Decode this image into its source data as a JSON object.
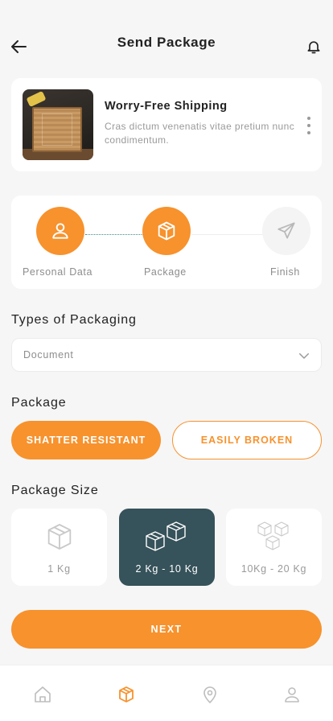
{
  "header": {
    "title": "Send Package",
    "back_icon": "arrow-left-icon",
    "bell_icon": "bell-icon"
  },
  "promo": {
    "title": "Worry-Free Shipping",
    "description": "Cras dictum venenatis vitae pretium nunc condimentum.",
    "more_icon": "more-vertical-icon"
  },
  "stepper": {
    "steps": [
      {
        "label": "Personal Data",
        "icon": "user-icon",
        "state": "active"
      },
      {
        "label": "Package",
        "icon": "package-icon",
        "state": "active"
      },
      {
        "label": "Finish",
        "icon": "send-icon",
        "state": "inactive"
      }
    ]
  },
  "packaging": {
    "title": "Types of Packaging",
    "selected": "Document"
  },
  "package": {
    "title": "Package",
    "options": [
      "SHATTER RESISTANT",
      "EASILY BROKEN"
    ],
    "selected": "SHATTER RESISTANT"
  },
  "package_size": {
    "title": "Package Size",
    "options": [
      "1 Kg",
      "2 Kg - 10 Kg",
      "10Kg - 20 Kg"
    ],
    "selected": "2 Kg - 10 Kg"
  },
  "next_label": "NEXT",
  "tabbar": {
    "items": [
      {
        "icon": "home-icon",
        "active": false
      },
      {
        "icon": "package-icon",
        "active": true
      },
      {
        "icon": "map-pin-icon",
        "active": false
      },
      {
        "icon": "user-icon",
        "active": false
      }
    ]
  },
  "colors": {
    "accent": "#F7922D",
    "selected_card": "#36525A",
    "muted_text": "#8D8D8D"
  }
}
